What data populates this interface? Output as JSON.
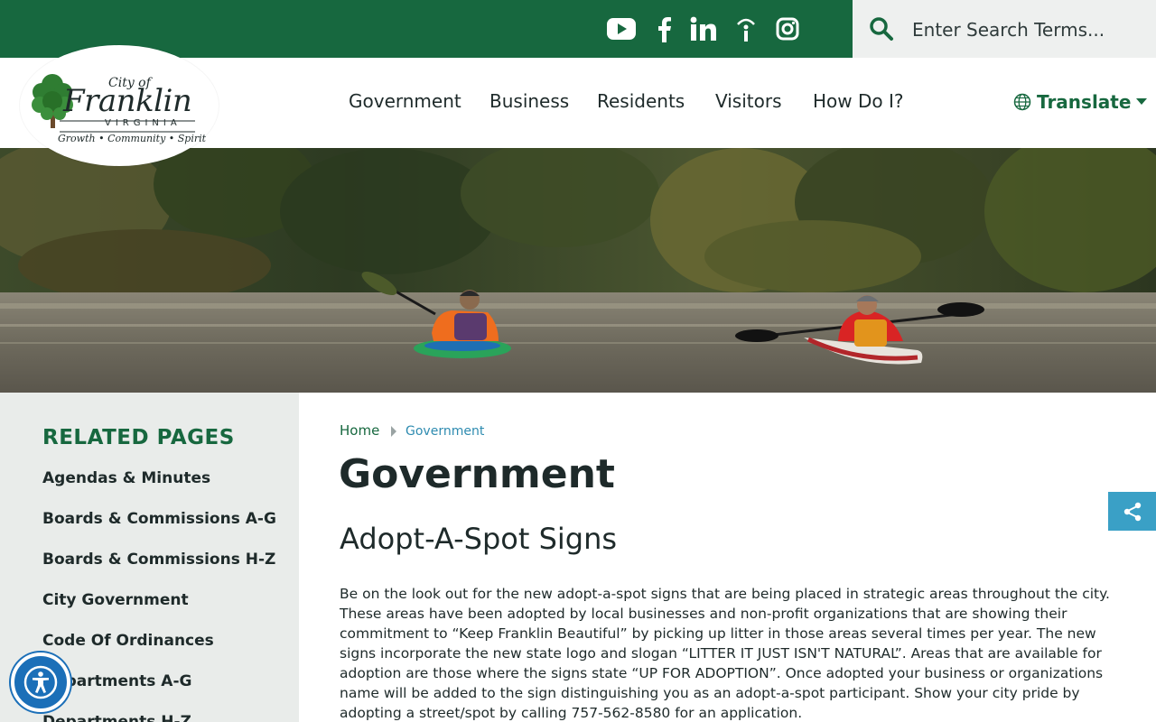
{
  "top_bar": {
    "social": [
      {
        "icon": "youtube-icon"
      },
      {
        "icon": "facebook-icon"
      },
      {
        "icon": "linkedin-icon"
      },
      {
        "icon": "info-app-icon"
      },
      {
        "icon": "instagram-icon"
      }
    ],
    "search_placeholder": "Enter Search Terms...",
    "search_icon": "search-icon"
  },
  "logo": {
    "city": "City of",
    "name": "Franklin",
    "state": "VIRGINIA",
    "tagline": "Growth • Community • Spirit"
  },
  "nav": {
    "items": [
      "Government",
      "Business",
      "Residents",
      "Visitors",
      "How Do I?"
    ],
    "translate_label": "Translate"
  },
  "sidebar": {
    "title": "RELATED PAGES",
    "links": [
      "Agendas & Minutes",
      "Boards & Commissions A-G",
      "Boards & Commissions H-Z",
      "City Government",
      "Code Of Ordinances",
      "Departments A-G",
      "Departments H-Z"
    ]
  },
  "breadcrumb": {
    "home": "Home",
    "current": "Government"
  },
  "main": {
    "title": "Government",
    "subtitle": "Adopt-A-Spot Signs",
    "body": "Be on the look out for the new adopt-a-spot signs that are being placed in strategic areas throughout the city. These areas have been adopted by local businesses and non-profit organizations that are showing their commitment to “Keep Franklin Beautiful” by picking up litter in those areas several times per year. The new signs incorporate the new state logo and slogan “LITTER IT JUST ISN'T NATURAL”. Areas that are available for adoption are those where the signs state “UP FOR ADOPTION”. Once adopted your business or organizations name will be added to the sign distinguishing you as an adopt-a-spot participant. Show your city pride by adopting a street/spot by calling 757-562-8580 for an application."
  },
  "colors": {
    "brand_green": "#17683f",
    "link_blue": "#2e8bb0",
    "share_blue": "#3aa0c6",
    "a11y_blue": "#1b6fb8"
  }
}
